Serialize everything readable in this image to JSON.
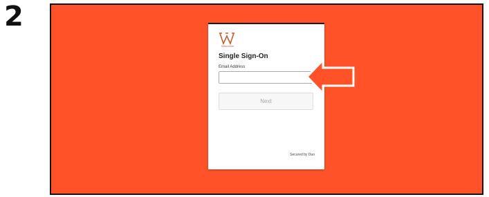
{
  "step_number": "2",
  "colors": {
    "frame_background": "#FF5228",
    "card_background": "#FFFFFF",
    "arrow_fill": "#FF5228",
    "arrow_outline": "#FFFFFF",
    "logo_color": "#C85A2E"
  },
  "login_card": {
    "logo_icon": "wisconsin-w-logo-icon",
    "logo_text": "Wisconsin",
    "title": "Single Sign-On",
    "email_label": "Email Address",
    "email_value": "",
    "next_button_label": "Next",
    "secured_by": "Secured by Duo"
  },
  "callout": {
    "icon": "left-arrow-callout-icon"
  }
}
